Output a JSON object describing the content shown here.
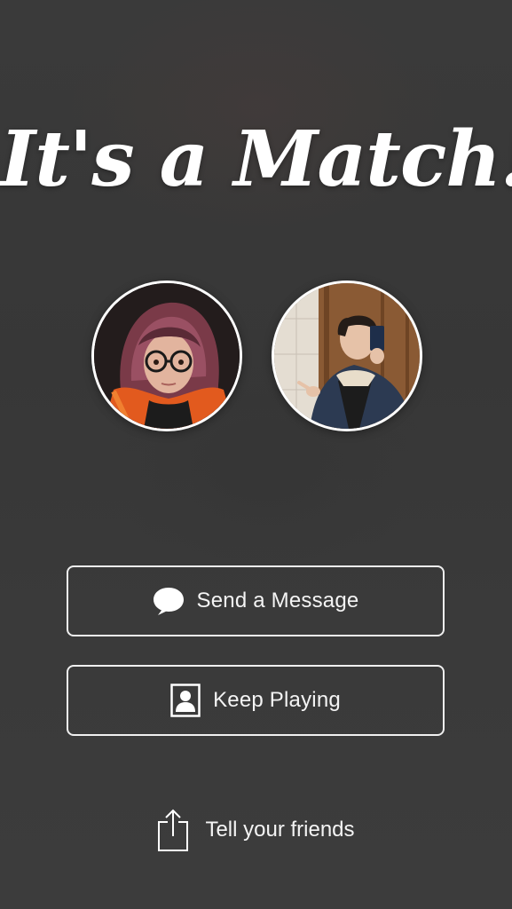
{
  "match": {
    "title": "It's a Match!"
  },
  "profiles": {
    "left_avatar_icon": "user-photo",
    "right_avatar_icon": "user-photo"
  },
  "actions": {
    "send_message_label": "Send a Message",
    "send_message_icon": "speech-bubble-icon",
    "keep_playing_label": "Keep Playing",
    "keep_playing_icon": "profile-card-icon",
    "share_label": "Tell your friends",
    "share_icon": "share-icon"
  },
  "colors": {
    "background": "#3b3b3b",
    "foreground": "#ffffff"
  }
}
